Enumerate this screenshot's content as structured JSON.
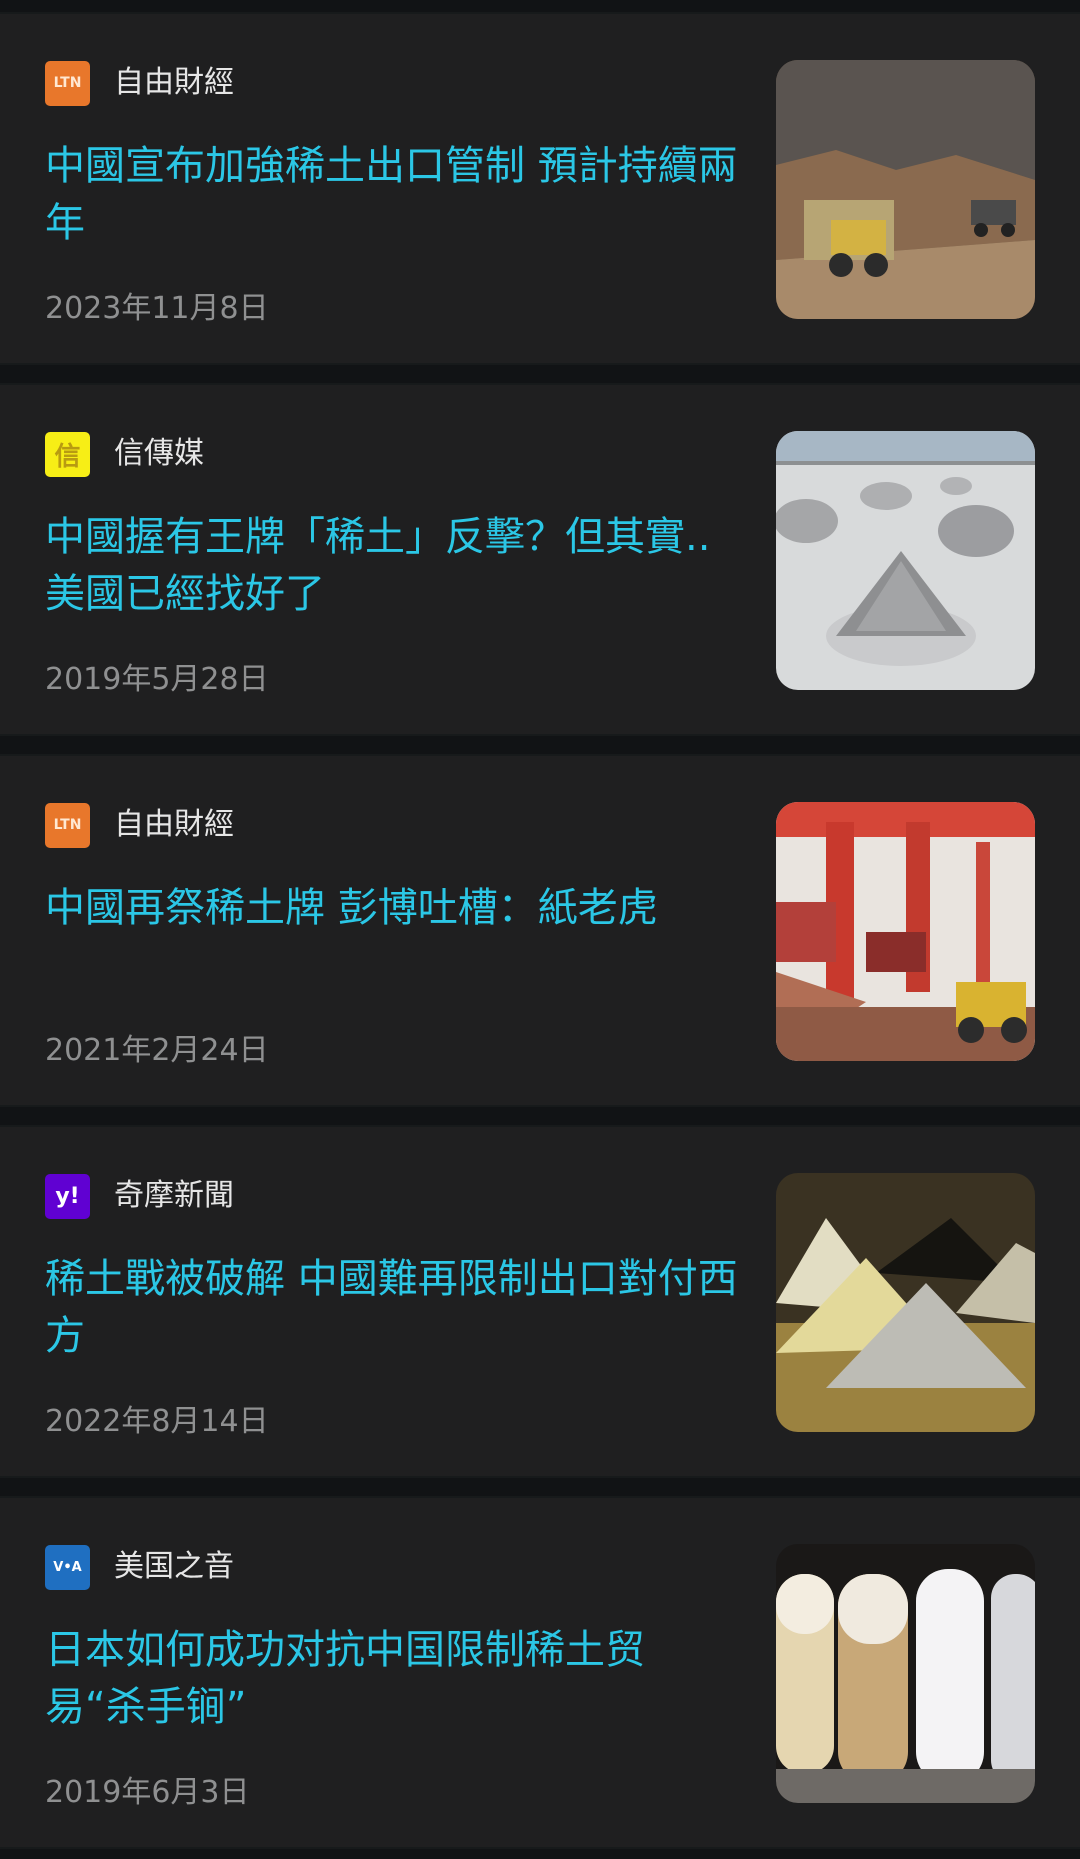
{
  "articles": [
    {
      "source": "自由財經",
      "source_logo": "LTN",
      "headline": "中國宣布加強稀土出口管制 預計持續兩年",
      "date": "2023年11月8日",
      "thumbnail": "mining-excavator-image"
    },
    {
      "source": "信傳媒",
      "source_logo": "信",
      "headline": "中國握有王牌「稀土」反擊？但其實..美國已經找好了",
      "date": "2019年5月28日",
      "thumbnail": "salt-flat-mounds-image"
    },
    {
      "source": "自由財經",
      "source_logo": "LTN",
      "headline": "中國再祭稀土牌 彭博吐槽：紙老虎",
      "date": "2021年2月24日",
      "thumbnail": "port-cranes-image"
    },
    {
      "source": "奇摩新聞",
      "source_logo": "y!",
      "headline": "稀土戰被破解 中國難再限制出口對付西方",
      "date": "2022年8月14日",
      "thumbnail": "rare-earth-powder-piles-image"
    },
    {
      "source": "美国之音",
      "source_logo": "V•A",
      "headline": "日本如何成功对抗中国限制稀土贸易“杀手锏”",
      "date": "2019年6月3日",
      "thumbnail": "powder-sample-jars-image"
    }
  ],
  "colors": {
    "page_background": "#111315",
    "card_background": "#1f1f20",
    "headline": "#2bc7e6",
    "source_text": "#e6e6e6",
    "date_text": "#8f9091"
  }
}
